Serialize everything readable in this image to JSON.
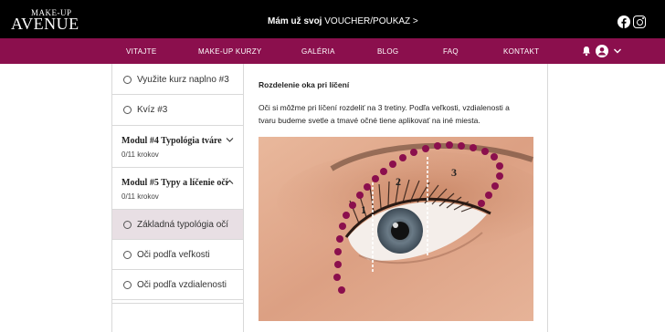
{
  "header": {
    "logo_top": "MAKE-UP",
    "logo_main": "AVENUE",
    "voucher_bold": "Mám už svoj",
    "voucher_rest": " VOUCHER/POUKAZ >"
  },
  "nav": {
    "items": [
      "VITAJTE",
      "MAKE-UP KURZY",
      "GALÉRIA",
      "BLOG",
      "FAQ",
      "KONTAKT"
    ]
  },
  "sidebar": {
    "steps_top": [
      "Využite kurz naplno #3",
      "Kvíz #3"
    ],
    "modules": [
      {
        "title": "Modul #4 Typológia tváre",
        "progress": "0/11 krokov",
        "expanded": false
      },
      {
        "title": "Modul #5 Typy a líčenie očí",
        "progress": "0/11 krokov",
        "expanded": true
      }
    ],
    "steps_module5": [
      "Základná typológia očí",
      "Oči podľa veľkosti",
      "Oči podľa vzdialenosti"
    ],
    "active_step": "Základná typológia očí"
  },
  "content": {
    "title": "Rozdelenie oka pri líčení",
    "paragraph": "Oči si môžme pri líčení rozdeliť na 3 tretiny. Podľa veľkosti, vzdialenosti a tvaru budeme svetle a tmavé očné tiene aplikovať na iné miesta.",
    "zone_labels": [
      "1",
      "2",
      "3"
    ]
  },
  "colors": {
    "brand": "#8b0f4d",
    "topbar": "#000000",
    "active_bg": "#e8dfe4",
    "dots": "#8b0f4d"
  }
}
